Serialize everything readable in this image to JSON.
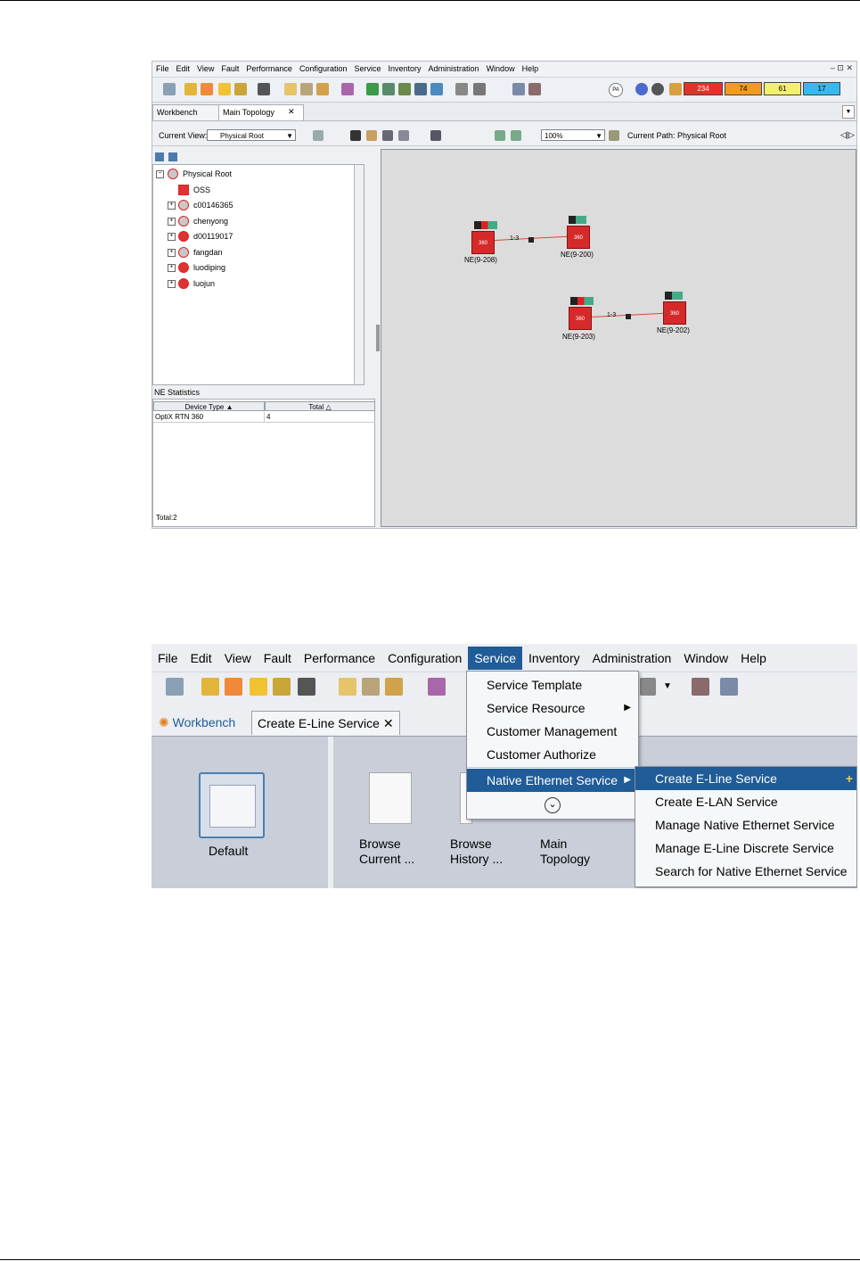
{
  "shot1": {
    "menu": [
      "File",
      "Edit",
      "View",
      "Fault",
      "Performance",
      "Configuration",
      "Service",
      "Inventory",
      "Administration",
      "Window",
      "Help"
    ],
    "window_controls": "– ⊡ ✕",
    "alarms": [
      {
        "value": "234",
        "color": "#e8302a"
      },
      {
        "value": "74",
        "color": "#f59a1c"
      },
      {
        "value": "61",
        "color": "#f4f06a"
      },
      {
        "value": "17",
        "color": "#35b9f0"
      }
    ],
    "pa_label": "PA",
    "tabs": [
      "Workbench",
      "Main Topology"
    ],
    "current_view_label": "Current View:",
    "current_view_value": "Physical Root",
    "zoom_value": "100%",
    "current_path": "Current Path: Physical Root",
    "tree": [
      "Physical Root",
      "OSS",
      "c00146365",
      "chenyong",
      "d00119017",
      "fangdan",
      "luodiping",
      "luojun"
    ],
    "stats_title": "NE Statistics",
    "stats_headers": [
      "Device Type ▲",
      "Total △"
    ],
    "stats_row": [
      "OptiX RTN 360",
      "4"
    ],
    "total_label": "Total:2",
    "ne_icon_text": "360",
    "nes": [
      "NE(9-208)",
      "NE(9-200)",
      "NE(9-203)",
      "NE(9-202)"
    ],
    "link_label": "1-3"
  },
  "shot2": {
    "menu": [
      "File",
      "Edit",
      "View",
      "Fault",
      "Performance",
      "Configuration",
      "Service",
      "Inventory",
      "Administration",
      "Window",
      "Help"
    ],
    "tabs": [
      "Workbench",
      "Create E-Line Service"
    ],
    "left_tile": "Default",
    "tiles": [
      {
        "line1": "Browse",
        "line2": "Current ..."
      },
      {
        "line1": "Browse",
        "line2": "History ..."
      },
      {
        "line1": "Main",
        "line2": "Topology"
      }
    ],
    "service_menu": [
      "Service Template",
      "Service Resource",
      "Customer Management",
      "Customer Authorize",
      "Native Ethernet Service"
    ],
    "more_icon": "⌄",
    "submenu": [
      "Create E-Line Service",
      "Create E-LAN Service",
      "Manage Native Ethernet Service",
      "Manage E-Line Discrete Service",
      "Search for Native Ethernet Service"
    ]
  }
}
